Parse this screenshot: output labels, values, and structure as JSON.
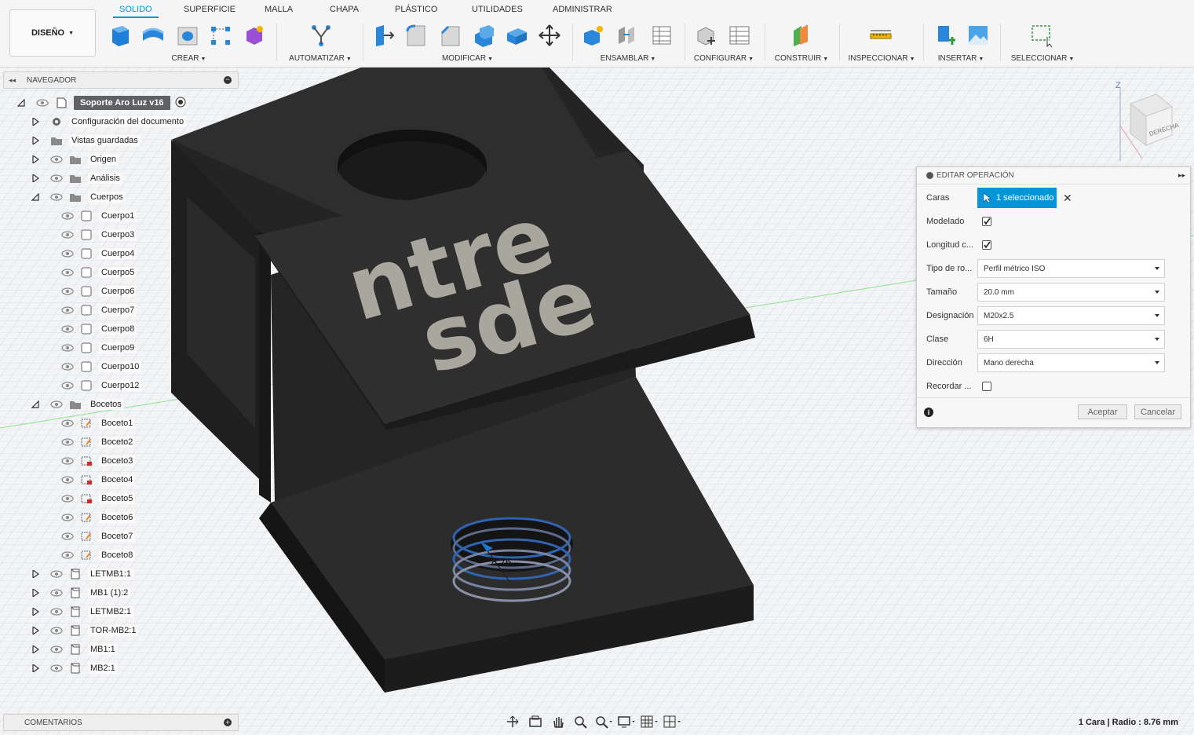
{
  "toolbar": {
    "workspace": "DISEÑO",
    "tabs": [
      "SOLIDO",
      "SUPERFICIE",
      "MALLA",
      "CHAPA",
      "PLÁSTICO",
      "UTILIDADES",
      "ADMINISTRAR"
    ],
    "active_tab": "SOLIDO",
    "groups": [
      "CREAR",
      "AUTOMATIZAR",
      "MODIFICAR",
      "ENSAMBLAR",
      "CONFIGURAR",
      "CONSTRUIR",
      "INSPECCIONAR",
      "INSERTAR",
      "SELECCIONAR"
    ]
  },
  "navigator": {
    "title": "NAVEGADOR",
    "root": "Soporte Aro Luz v16",
    "items": [
      {
        "label": "Configuración del documento",
        "icon": "gear-icon"
      },
      {
        "label": "Vistas guardadas",
        "icon": "folder-icon"
      },
      {
        "label": "Origen",
        "icon": "folder-icon"
      },
      {
        "label": "Análisis",
        "icon": "folder-icon"
      },
      {
        "label": "Cuerpos",
        "icon": "folder-icon"
      },
      {
        "label": "Cuerpo1",
        "icon": "body-icon"
      },
      {
        "label": "Cuerpo3",
        "icon": "body-icon"
      },
      {
        "label": "Cuerpo4",
        "icon": "body-icon"
      },
      {
        "label": "Cuerpo5",
        "icon": "body-icon"
      },
      {
        "label": "Cuerpo6",
        "icon": "body-icon"
      },
      {
        "label": "Cuerpo7",
        "icon": "body-icon"
      },
      {
        "label": "Cuerpo8",
        "icon": "body-icon"
      },
      {
        "label": "Cuerpo9",
        "icon": "body-icon"
      },
      {
        "label": "Cuerpo10",
        "icon": "body-icon"
      },
      {
        "label": "Cuerpo12",
        "icon": "body-icon"
      },
      {
        "label": "Bocetos",
        "icon": "folder-icon"
      },
      {
        "label": "Boceto1",
        "icon": "sketch-icon"
      },
      {
        "label": "Boceto2",
        "icon": "sketch-icon"
      },
      {
        "label": "Boceto3",
        "icon": "sketch-locked-icon"
      },
      {
        "label": "Boceto4",
        "icon": "sketch-locked-icon"
      },
      {
        "label": "Boceto5",
        "icon": "sketch-locked-icon"
      },
      {
        "label": "Boceto6",
        "icon": "sketch-icon"
      },
      {
        "label": "Boceto7",
        "icon": "sketch-icon"
      },
      {
        "label": "Boceto8",
        "icon": "sketch-icon"
      },
      {
        "label": "LETMB1:1",
        "icon": "component-icon"
      },
      {
        "label": "MB1 (1):2",
        "icon": "component-icon"
      },
      {
        "label": "LETMB2:1",
        "icon": "component-icon"
      },
      {
        "label": "TOR-MB2:1",
        "icon": "component-icon"
      },
      {
        "label": "MB1:1",
        "icon": "component-icon"
      },
      {
        "label": "MB2:1",
        "icon": "component-icon"
      }
    ]
  },
  "comments": {
    "title": "COMENTARIOS"
  },
  "dialog": {
    "title": "EDITAR OPERACIÓN",
    "caras_label": "Caras",
    "caras_value": "1 seleccionado",
    "modelado_label": "Modelado",
    "modelado_checked": true,
    "longitud_label": "Longitud c...",
    "longitud_checked": true,
    "tipo_label": "Tipo de ro...",
    "tipo_value": "Perfil métrico ISO",
    "tamano_label": "Tamaño",
    "tamano_value": "20.0 mm",
    "designacion_label": "Designación",
    "designacion_value": "M20x2.5",
    "clase_label": "Clase",
    "clase_value": "6H",
    "direccion_label": "Dirección",
    "direccion_value": "Mano derecha",
    "recordar_label": "Recordar ...",
    "recordar_checked": false,
    "accept": "Aceptar",
    "cancel": "Cancelar"
  },
  "viewport": {
    "model_text_line1": "ntre",
    "model_text_line2": "sde",
    "dimension_label": "8.76",
    "viewcube_label": "DERECHA",
    "viewcube_axis": "Z"
  },
  "status": "1 Cara | Radio : 8.76 mm",
  "colors": {
    "accent": "#0696d7",
    "model": "#2b2b2b",
    "text_inlay": "#a9a69d"
  }
}
